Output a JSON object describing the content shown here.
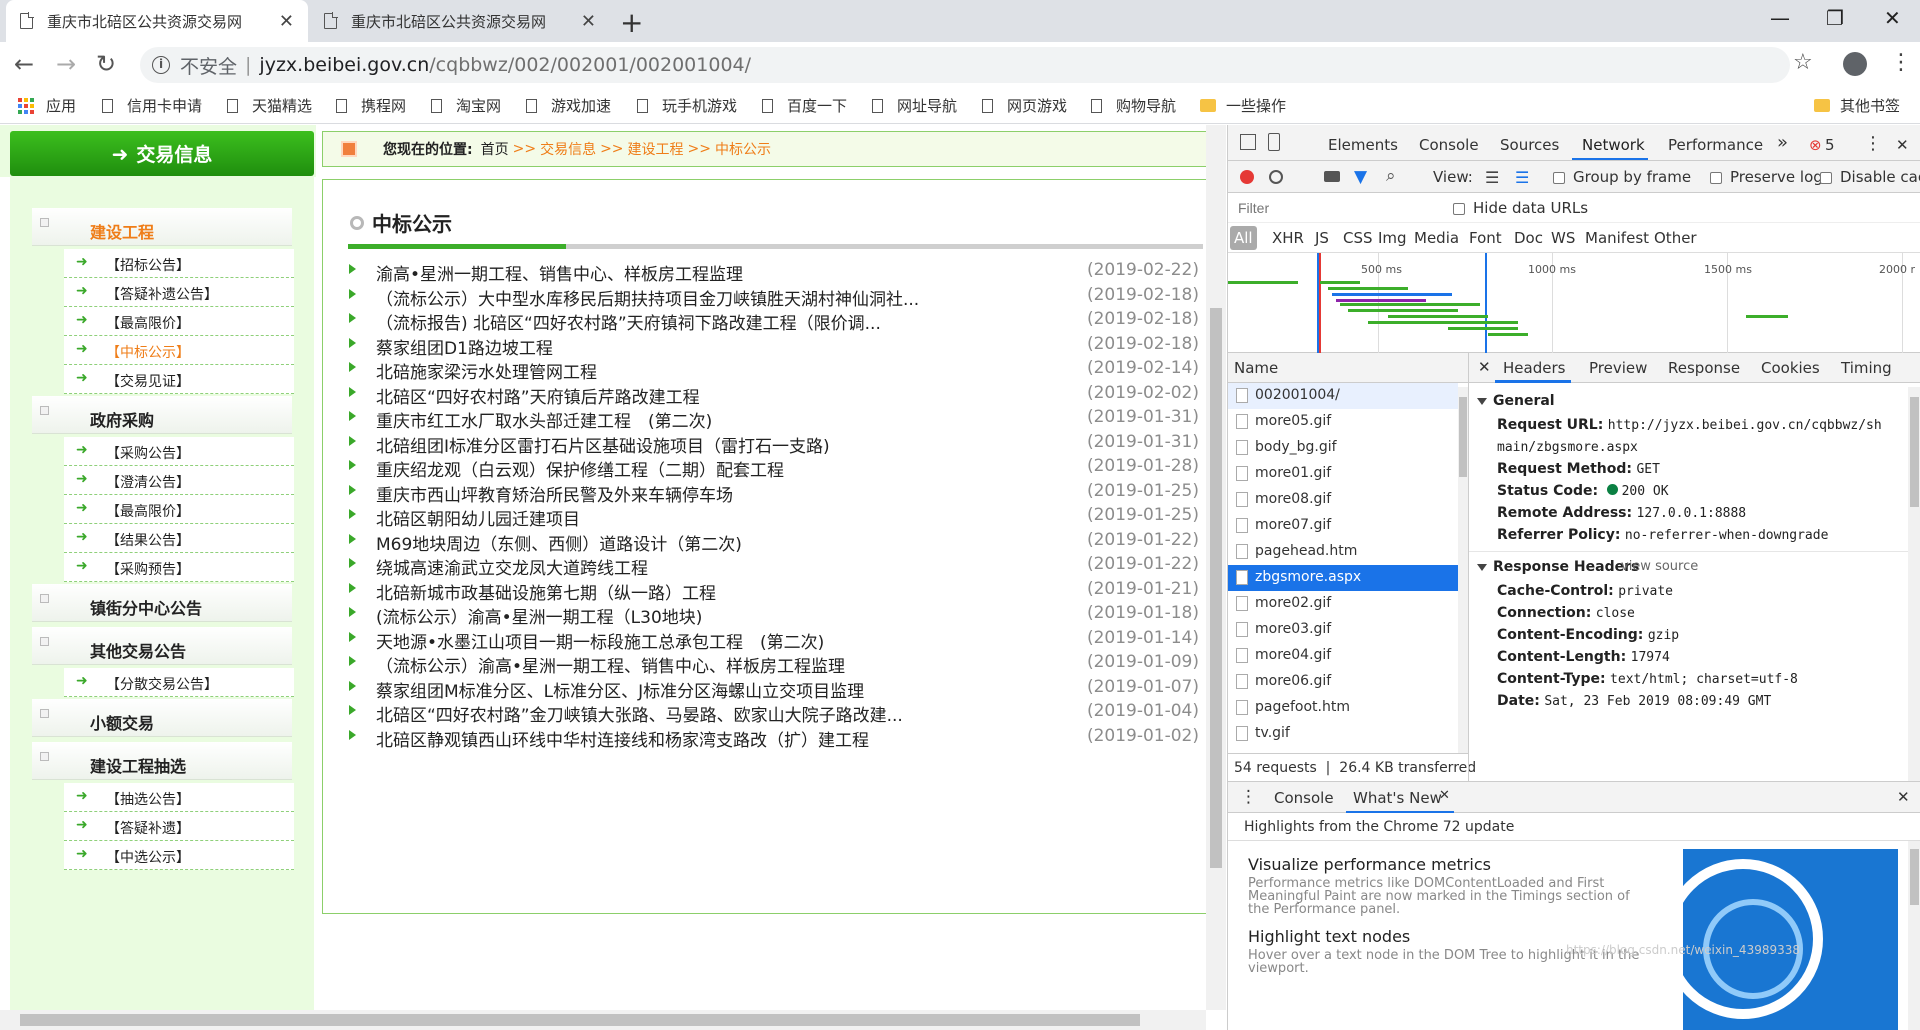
{
  "browser": {
    "tabs": [
      {
        "title": "重庆市北碚区公共资源交易网"
      },
      {
        "title": "重庆市北碚区公共资源交易网"
      }
    ],
    "new_tab": "+",
    "window": {
      "min": "—",
      "max": "❐",
      "close": "✕"
    },
    "nav": {
      "back": "←",
      "forward": "→",
      "reload": "↻"
    },
    "omnibox": {
      "security": "不安全",
      "separator": "|",
      "host": "jyzx.beibei.gov.cn",
      "path": "/cqbbwz/002/002001/002001004/"
    },
    "star": "☆",
    "menu": "⋮",
    "bookmarks": [
      "应用",
      "信用卡申请",
      "天猫精选",
      "携程网",
      "淘宝网",
      "游戏加速",
      "玩手机游戏",
      "百度一下",
      "网址导航",
      "网页游戏",
      "购物导航",
      "一些操作"
    ],
    "other_bookmarks": "其他书签"
  },
  "site": {
    "banner": "交易信息",
    "banner_arrow": "➜",
    "breadcrumb": {
      "you_are_here": "您现在的位置:",
      "home": "首页",
      "sep": ">>",
      "links": [
        "交易信息",
        "建设工程",
        "中标公示"
      ]
    },
    "sidebar": {
      "sec_construction": "建设工程",
      "construction_items": [
        "【招标公告】",
        "【答疑补遗公告】",
        "【最高限价】",
        "【中标公示】",
        "【交易见证】"
      ],
      "sec_procurement": "政府采购",
      "procurement_items": [
        "【采购公告】",
        "【澄清公告】",
        "【最高限价】",
        "【结果公告】",
        "【采购预告】"
      ],
      "sec_town": "镇街分中心公告",
      "sec_other": "其他交易公告",
      "other_items": [
        "【分散交易公告】"
      ],
      "sec_small": "小额交易",
      "sec_draw": "建设工程抽选",
      "draw_items": [
        "【抽选公告】",
        "【答疑补遗】",
        "【中选公示】"
      ]
    },
    "main": {
      "title": "中标公示",
      "rows": [
        {
          "title": "渝高•星洲一期工程、销售中心、样板房工程监理",
          "date": "(2019-02-22)"
        },
        {
          "title": "（流标公示）大中型水库移民后期扶持项目金刀峡镇胜天湖村神仙洞社...",
          "date": "(2019-02-18)"
        },
        {
          "title": "（流标报告) 北碚区“四好农村路”天府镇祠下路改建工程（限价调...",
          "date": "(2019-02-18)"
        },
        {
          "title": "蔡家组团D1路边坡工程",
          "date": "(2019-02-18)"
        },
        {
          "title": "北碚施家梁污水处理管网工程",
          "date": "(2019-02-14)"
        },
        {
          "title": "北碚区“四好农村路”天府镇后芹路改建工程",
          "date": "(2019-02-02)"
        },
        {
          "title": "重庆市红工水厂取水头部迁建工程　(第二次)",
          "date": "(2019-01-31)"
        },
        {
          "title": "北碚组团I标准分区雷打石片区基础设施项目（雷打石一支路)",
          "date": "(2019-01-31)"
        },
        {
          "title": "重庆绍龙观（白云观）保护修缮工程（二期）配套工程",
          "date": "(2019-01-28)"
        },
        {
          "title": "重庆市西山坪教育矫治所民警及外来车辆停车场",
          "date": "(2019-01-25)"
        },
        {
          "title": "北碚区朝阳幼儿园迁建项目",
          "date": "(2019-01-25)"
        },
        {
          "title": "M69地块周边（东侧、西侧）道路设计（第二次)",
          "date": "(2019-01-22)"
        },
        {
          "title": "绕城高速渝武立交龙凤大道跨线工程",
          "date": "(2019-01-22)"
        },
        {
          "title": "北碚新城市政基础设施第七期（纵一路）工程",
          "date": "(2019-01-21)"
        },
        {
          "title": "(流标公示）渝高•星洲一期工程（L30地块)",
          "date": "(2019-01-18)"
        },
        {
          "title": "天地源•水墨江山项目一期一标段施工总承包工程　(第二次)",
          "date": "(2019-01-14)"
        },
        {
          "title": "（流标公示）渝高•星洲一期工程、销售中心、样板房工程监理",
          "date": "(2019-01-09)"
        },
        {
          "title": "蔡家组团M标准分区、L标准分区、J标准分区海螺山立交项目监理",
          "date": "(2019-01-07)"
        },
        {
          "title": "北碚区“四好农村路”金刀峡镇大张路、马晏路、欧家山大院子路改建...",
          "date": "(2019-01-04)"
        },
        {
          "title": "北碚区静观镇西山环线中华村连接线和杨家湾支路改（扩）建工程",
          "date": "(2019-01-02)"
        }
      ]
    }
  },
  "devtools": {
    "tabs": [
      "Elements",
      "Console",
      "Sources",
      "Network",
      "Performance"
    ],
    "more": "»",
    "error_count": "5",
    "error_icon": "⊗",
    "kebab": "⋮",
    "close": "✕",
    "toolbar": {
      "view": "View:",
      "group_by_frame": "Group by frame",
      "preserve_log": "Preserve log",
      "disable_cache": "Disable cac"
    },
    "filter_placeholder": "Filter",
    "hide_data_urls": "Hide data URLs",
    "types": [
      "All",
      "XHR",
      "JS",
      "CSS",
      "Img",
      "Media",
      "Font",
      "Doc",
      "WS",
      "Manifest",
      "Other"
    ],
    "timeline_ticks": [
      "500 ms",
      "1000 ms",
      "1500 ms",
      "2000 r"
    ],
    "name_header": "Name",
    "requests": [
      "002001004/",
      "more05.gif",
      "body_bg.gif",
      "more01.gif",
      "more08.gif",
      "more07.gif",
      "pagehead.htm",
      "zbgsmore.aspx",
      "more02.gif",
      "more03.gif",
      "more04.gif",
      "more06.gif",
      "pagefoot.htm",
      "tv.gif"
    ],
    "summary": "54 requests  |  26.4 KB transferred",
    "detail_tabs": [
      "Headers",
      "Preview",
      "Response",
      "Cookies",
      "Timing"
    ],
    "general": {
      "title": "General",
      "request_url_k": "Request URL:",
      "request_url_v": "http://jyzx.beibei.gov.cn/cqbbwz/sh",
      "request_url_v2": "main/zbgsmore.aspx",
      "method_k": "Request Method:",
      "method_v": "GET",
      "status_k": "Status Code:",
      "status_v": "200 OK",
      "remote_k": "Remote Address:",
      "remote_v": "127.0.0.1:8888",
      "referrer_k": "Referrer Policy:",
      "referrer_v": "no-referrer-when-downgrade"
    },
    "response_headers": {
      "title": "Response Headers",
      "view_source": "view source",
      "cache_k": "Cache-Control:",
      "cache_v": "private",
      "conn_k": "Connection:",
      "conn_v": "close",
      "enc_k": "Content-Encoding:",
      "enc_v": "gzip",
      "len_k": "Content-Length:",
      "len_v": "17974",
      "type_k": "Content-Type:",
      "type_v": "text/html; charset=utf-8",
      "date_k": "Date:",
      "date_v": "Sat, 23 Feb 2019 08:09:49 GMT"
    },
    "drawer": {
      "tabs": [
        "Console",
        "What's New"
      ],
      "headline": "Highlights from the Chrome 72 update",
      "items": [
        {
          "title": "Visualize performance metrics",
          "body": "Performance metrics like DOMContentLoaded and First Meaningful Paint are now marked in the Timings section of the Performance panel."
        },
        {
          "title": "Highlight text nodes",
          "body": "Hover over a text node in the DOM Tree to highlight it in the viewport."
        }
      ]
    },
    "watermark": "https://blog.csdn.net/weixin_43989338"
  },
  "colors": {
    "accent_green": "#3cae2a",
    "link_orange": "#ef7d18",
    "devtools_blue": "#1a73e8"
  }
}
